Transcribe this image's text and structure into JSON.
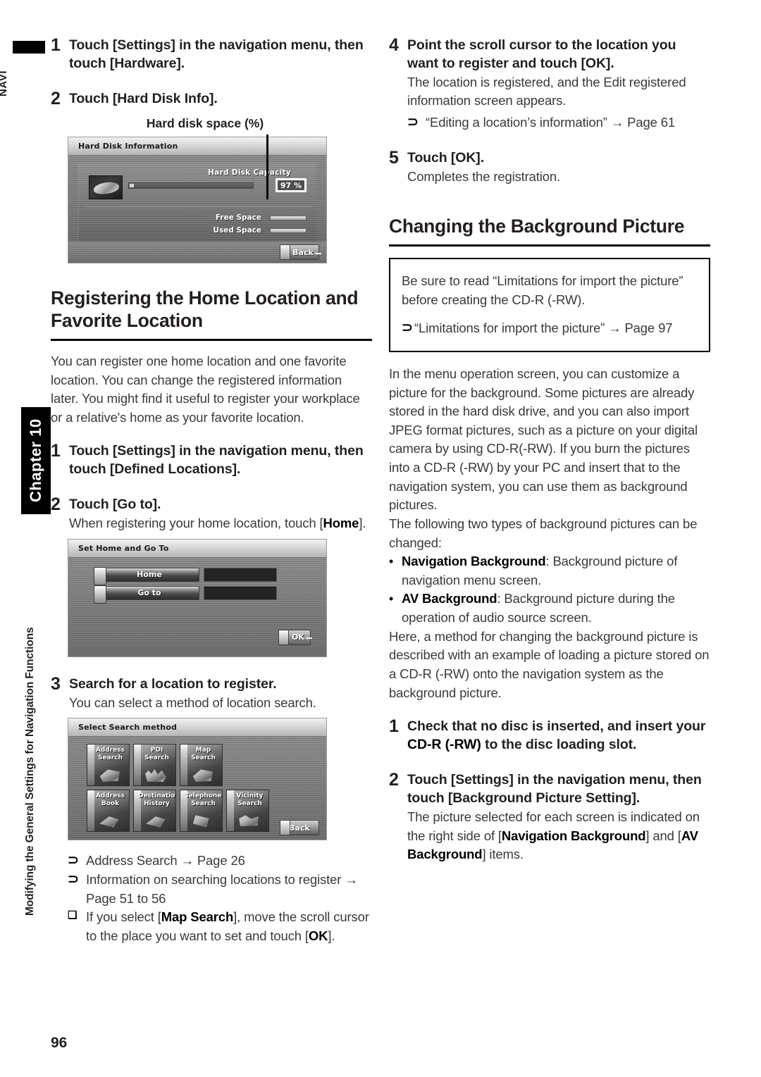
{
  "page": {
    "number": "96",
    "navi_tag": "NAVI",
    "chapter_label": "Chapter 10",
    "running_head": "Modifying the General Settings for Navigation Functions"
  },
  "left_column": {
    "step1": {
      "num": "1",
      "title": "Touch [Settings] in the navigation menu, then touch [Hardware]."
    },
    "step2": {
      "num": "2",
      "title": "Touch [Hard Disk Info]."
    },
    "callout": {
      "label": "Hard disk space (%)"
    },
    "hard_disk_screen": {
      "title": "Hard Disk Information",
      "capacity_label": "Hard Disk Capacity",
      "percent": "97 %",
      "free_space_label": "Free Space",
      "used_space_label": "Used Space",
      "back_label": "Back",
      "disk_icon": "hard-disk-icon"
    },
    "section_heading": "Registering the Home Location and Favorite Location",
    "intro": "You can register one home location and one favorite location. You can change the registered information later. You might find it useful to register your workplace or a relative's home as your favorite location.",
    "reg_step1": {
      "num": "1",
      "title": "Touch [Settings] in the navigation menu, then touch [Defined Locations]."
    },
    "reg_step2": {
      "num": "2",
      "title": "Touch [Go to].",
      "desc_pre": "When registering your home location, touch [",
      "desc_bold": "Home",
      "desc_post": "]."
    },
    "home_screen": {
      "title": "Set Home and Go To",
      "row1_label": "Home",
      "row2_label": "Go to",
      "ok_label": "OK"
    },
    "reg_step3": {
      "num": "3",
      "title": "Search for a location to register.",
      "desc": "You can select a method of location search."
    },
    "search_screen": {
      "title": "Select Search method",
      "buttons": [
        {
          "line1": "Address",
          "line2": "Search",
          "icon": "address-search-icon"
        },
        {
          "line1": "POI",
          "line2": "Search",
          "icon": "poi-search-icon"
        },
        {
          "line1": "Map",
          "line2": "Search",
          "icon": "map-search-icon"
        },
        {
          "line1": "Address",
          "line2": "Book",
          "icon": "address-book-icon"
        },
        {
          "line1": "Destination",
          "line2": "History",
          "icon": "destination-history-icon"
        },
        {
          "line1": "Telephone",
          "line2": "Search",
          "icon": "telephone-search-icon"
        },
        {
          "line1": "Vicinity",
          "line2": "Search",
          "icon": "vicinity-search-icon"
        }
      ],
      "back_label": "Back"
    },
    "refs": [
      {
        "mark": "⊃",
        "text": "Address Search → Page 26"
      },
      {
        "mark": "⊃",
        "text": "Information on searching locations to register → Page 51 to 56"
      }
    ],
    "note_ref": {
      "mark": "❑",
      "pre": "If you select [",
      "bold1": "Map Search",
      "mid": "], move the scroll cursor to the place you want to set and touch [",
      "bold2": "OK",
      "post": "]."
    }
  },
  "right_column": {
    "step4": {
      "num": "4",
      "title": "Point the scroll cursor to the location you want to register and touch [OK].",
      "desc": "The location is registered, and the Edit registered information screen appears.",
      "ref_mark": "⊃",
      "ref_text": "“Editing a location’s information” → Page 61"
    },
    "step5": {
      "num": "5",
      "title": "Touch [OK].",
      "desc": "Completes the registration."
    },
    "section_heading": "Changing the Background Picture",
    "notebox": {
      "body": "Be sure to read “Limitations for import the picture” before creating the CD-R (-RW).",
      "ref_mark": "⊃",
      "ref_text": "“Limitations for import the picture” → Page 97"
    },
    "body_para": "In the menu operation screen, you can customize a picture for the background. Some pictures are already stored in the hard disk drive, and you can also import JPEG format pictures, such as a picture on your digital camera by using CD-R(-RW). If you burn the pictures into a CD-R (-RW) by your PC and insert that to the navigation system, you can use them as background pictures.",
    "types_intro": "The following two types of background pictures can be changed:",
    "bullets": [
      {
        "dot": "•",
        "bold": "Navigation Background",
        "text": ": Background picture of navigation menu screen."
      },
      {
        "dot": "•",
        "bold": "AV Background",
        "text": ": Background picture during the operation of audio source screen."
      }
    ],
    "closing_para": "Here, a method for changing the background picture is described with an example of loading a picture stored on a CD-R (-RW) onto the navigation system as the background picture.",
    "bg_step1": {
      "num": "1",
      "title_pre": "Check that no disc is inserted, and insert your ",
      "title_bold": "CD-R (-RW)",
      "title_post": " to the disc loading slot."
    },
    "bg_step2": {
      "num": "2",
      "title": "Touch [Settings] in the navigation menu, then touch [Background Picture Setting].",
      "desc_pre": "The picture selected for each screen is indicated on the right side of [",
      "desc_bold1": "Navigation Background",
      "desc_mid": "] and [",
      "desc_bold2": "AV Background",
      "desc_post": "] items."
    }
  }
}
